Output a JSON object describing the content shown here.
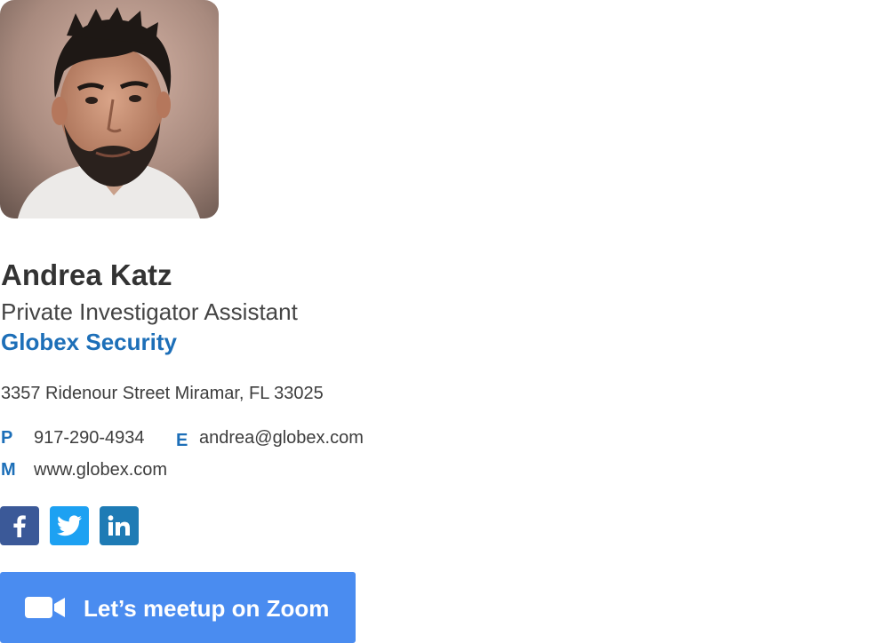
{
  "profile": {
    "name": "Andrea Katz",
    "job_title": "Private Investigator Assistant",
    "company": "Globex Security",
    "address": "3357 Ridenour Street Miramar, FL 33025"
  },
  "contacts": {
    "phone": {
      "label": "P",
      "value": "917-290-4934"
    },
    "email": {
      "label": "E",
      "value": "andrea@globex.com"
    },
    "website": {
      "label": "M",
      "value": "www.globex.com"
    }
  },
  "social": [
    {
      "name": "facebook-icon",
      "color": "#3b5998"
    },
    {
      "name": "twitter-icon",
      "color": "#1da1f2"
    },
    {
      "name": "linkedin-icon",
      "color": "#1e7bb5"
    }
  ],
  "colors": {
    "accent": "#1d6fb8",
    "zoom_button": "#4a8cf0"
  },
  "cta": {
    "label": "Let’s meetup on Zoom",
    "icon": "video-camera-icon"
  }
}
